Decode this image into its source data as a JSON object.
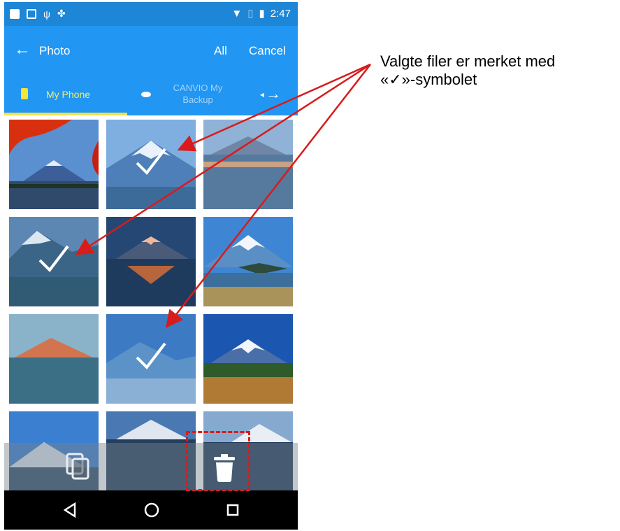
{
  "statusbar": {
    "time": "2:47"
  },
  "appbar": {
    "back_icon": "arrow-left-icon",
    "title": "Photo",
    "action_all": "All",
    "action_cancel": "Cancel"
  },
  "tabs": [
    {
      "label": "My Phone",
      "icon": "phone-icon",
      "selected": true
    },
    {
      "label": "CANVIO My Backup",
      "icon": "drive-icon",
      "selected": false
    }
  ],
  "photos": [
    {
      "row": 1,
      "col": 1,
      "selected": false
    },
    {
      "row": 1,
      "col": 2,
      "selected": true
    },
    {
      "row": 1,
      "col": 3,
      "selected": false
    },
    {
      "row": 2,
      "col": 1,
      "selected": true
    },
    {
      "row": 2,
      "col": 2,
      "selected": false
    },
    {
      "row": 2,
      "col": 3,
      "selected": false
    },
    {
      "row": 3,
      "col": 1,
      "selected": false
    },
    {
      "row": 3,
      "col": 2,
      "selected": true
    },
    {
      "row": 3,
      "col": 3,
      "selected": false
    },
    {
      "row": 4,
      "col": 1,
      "selected": false
    },
    {
      "row": 4,
      "col": 2,
      "selected": false
    },
    {
      "row": 4,
      "col": 3,
      "selected": false
    }
  ],
  "actions": {
    "copy_icon": "copy-icon",
    "delete_icon": "trash-icon"
  },
  "navbar": {
    "back_icon": "triangle-back-icon",
    "home_icon": "circle-home-icon",
    "recent_icon": "square-recent-icon"
  },
  "callout": {
    "line1": "Valgte filer er merket med",
    "line2": "«✓»-symbolet"
  },
  "colors": {
    "appbar": "#2196f3",
    "statusbar": "#1d86d6",
    "tab_indicator": "#f4e04d",
    "annotation": "#d81b1b"
  }
}
